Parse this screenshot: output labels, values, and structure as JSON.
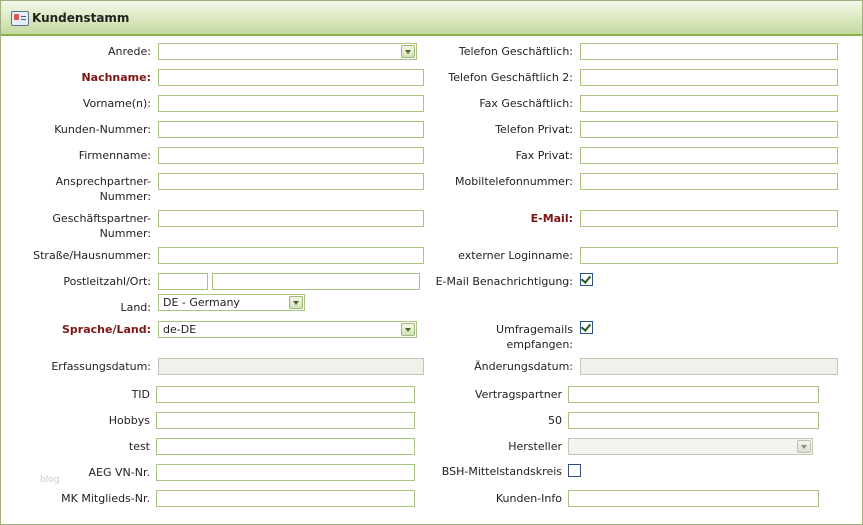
{
  "window": {
    "title": "Kundenstamm",
    "icon": "address-card-icon"
  },
  "colors": {
    "header_accent": "#8cb048",
    "required_label": "#7b1515",
    "input_border": "#a9c584"
  },
  "left": {
    "anrede": {
      "label": "Anrede:",
      "value": ""
    },
    "nachname": {
      "label": "Nachname:",
      "value": ""
    },
    "vorname": {
      "label": "Vorname(n):",
      "value": ""
    },
    "kundennummer": {
      "label": "Kunden-Nummer:",
      "value": ""
    },
    "firmenname": {
      "label": "Firmenname:",
      "value": ""
    },
    "ansprechpartner": {
      "label_line1": "Ansprechpartner-",
      "label_line2": "Nummer:",
      "value": ""
    },
    "geschaeftspartner": {
      "label_line1": "Geschäftspartner-",
      "label_line2": "Nummer:",
      "value": ""
    },
    "strasse": {
      "label": "Straße/Hausnummer:",
      "value": ""
    },
    "plz_ort": {
      "label": "Postleitzahl/Ort:",
      "plz": "",
      "ort": ""
    },
    "land": {
      "label": "Land:",
      "value": "DE - Germany"
    },
    "sprache": {
      "label": "Sprache/Land:",
      "value": "de-DE"
    },
    "erfassungsdatum": {
      "label": "Erfassungsdatum:",
      "value": ""
    },
    "tid": {
      "label": "TID",
      "value": ""
    },
    "hobbys": {
      "label": "Hobbys",
      "value": ""
    },
    "test": {
      "label": "test",
      "value": ""
    },
    "aeg": {
      "label": "AEG VN-Nr.",
      "value": ""
    },
    "mk": {
      "label": "MK Mitglieds-Nr.",
      "value": ""
    }
  },
  "right": {
    "tel_geschaeftlich": {
      "label": "Telefon Geschäftlich:",
      "value": ""
    },
    "tel_geschaeftlich2": {
      "label": "Telefon Geschäftlich 2:",
      "value": ""
    },
    "fax_geschaeftlich": {
      "label": "Fax Geschäftlich:",
      "value": ""
    },
    "tel_privat": {
      "label": "Telefon Privat:",
      "value": ""
    },
    "fax_privat": {
      "label": "Fax Privat:",
      "value": ""
    },
    "mobil": {
      "label": "Mobiltelefonnummer:",
      "value": ""
    },
    "email": {
      "label": "E-Mail:",
      "value": ""
    },
    "login": {
      "label": "externer Loginname:",
      "value": ""
    },
    "email_benachrichtigung": {
      "label": "E-Mail Benachrichtigung:",
      "checked": true
    },
    "umfragemails": {
      "label_line1": "Umfragemails",
      "label_line2": "empfangen:",
      "checked": true
    },
    "aenderungsdatum": {
      "label": "Änderungsdatum:",
      "value": ""
    },
    "vertragspartner": {
      "label": "Vertragspartner",
      "value": ""
    },
    "fuenfzig": {
      "label": "50",
      "value": ""
    },
    "hersteller": {
      "label": "Hersteller",
      "value": ""
    },
    "bsh": {
      "label": "BSH-Mittelstandskreis",
      "checked": false
    },
    "kundeninfo": {
      "label": "Kunden-Info",
      "value": ""
    }
  },
  "watermark": "blog"
}
